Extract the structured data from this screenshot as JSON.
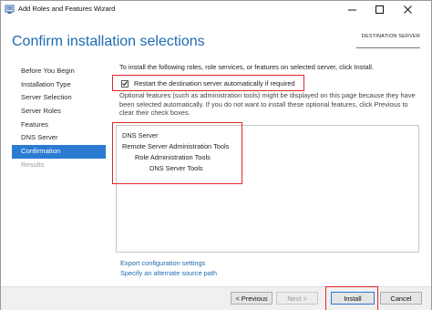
{
  "window": {
    "title": "Add Roles and Features Wizard"
  },
  "header": {
    "page_title": "Confirm installation selections",
    "destination_label": "DESTINATION SERVER"
  },
  "nav": {
    "items": [
      {
        "label": "Before You Begin",
        "state": "normal"
      },
      {
        "label": "Installation Type",
        "state": "normal"
      },
      {
        "label": "Server Selection",
        "state": "normal"
      },
      {
        "label": "Server Roles",
        "state": "normal"
      },
      {
        "label": "Features",
        "state": "normal"
      },
      {
        "label": "DNS Server",
        "state": "normal"
      },
      {
        "label": "Confirmation",
        "state": "active"
      },
      {
        "label": "Results",
        "state": "disabled"
      }
    ]
  },
  "main": {
    "intro": "To install the following roles, role services, or features on selected server, click Install.",
    "restart_label": "Restart the destination server automatically if required",
    "restart_checked": true,
    "optional_text": "Optional features (such as administration tools) might be displayed on this page because they have been selected automatically. If you do not want to install these optional features, click Previous to clear their check boxes.",
    "selections": [
      {
        "label": "DNS Server",
        "level": 0
      },
      {
        "label": "Remote Server Administration Tools",
        "level": 0
      },
      {
        "label": "Role Administration Tools",
        "level": 1
      },
      {
        "label": "DNS Server Tools",
        "level": 2
      }
    ],
    "export_link": "Export configuration settings",
    "source_link": "Specify an alternate source path"
  },
  "footer": {
    "previous_label": "< Previous",
    "next_label": "Next >",
    "install_label": "Install",
    "cancel_label": "Cancel"
  },
  "colors": {
    "accent": "#2b7bd3",
    "title": "#1e6ab0",
    "highlight": "#e0262d"
  }
}
